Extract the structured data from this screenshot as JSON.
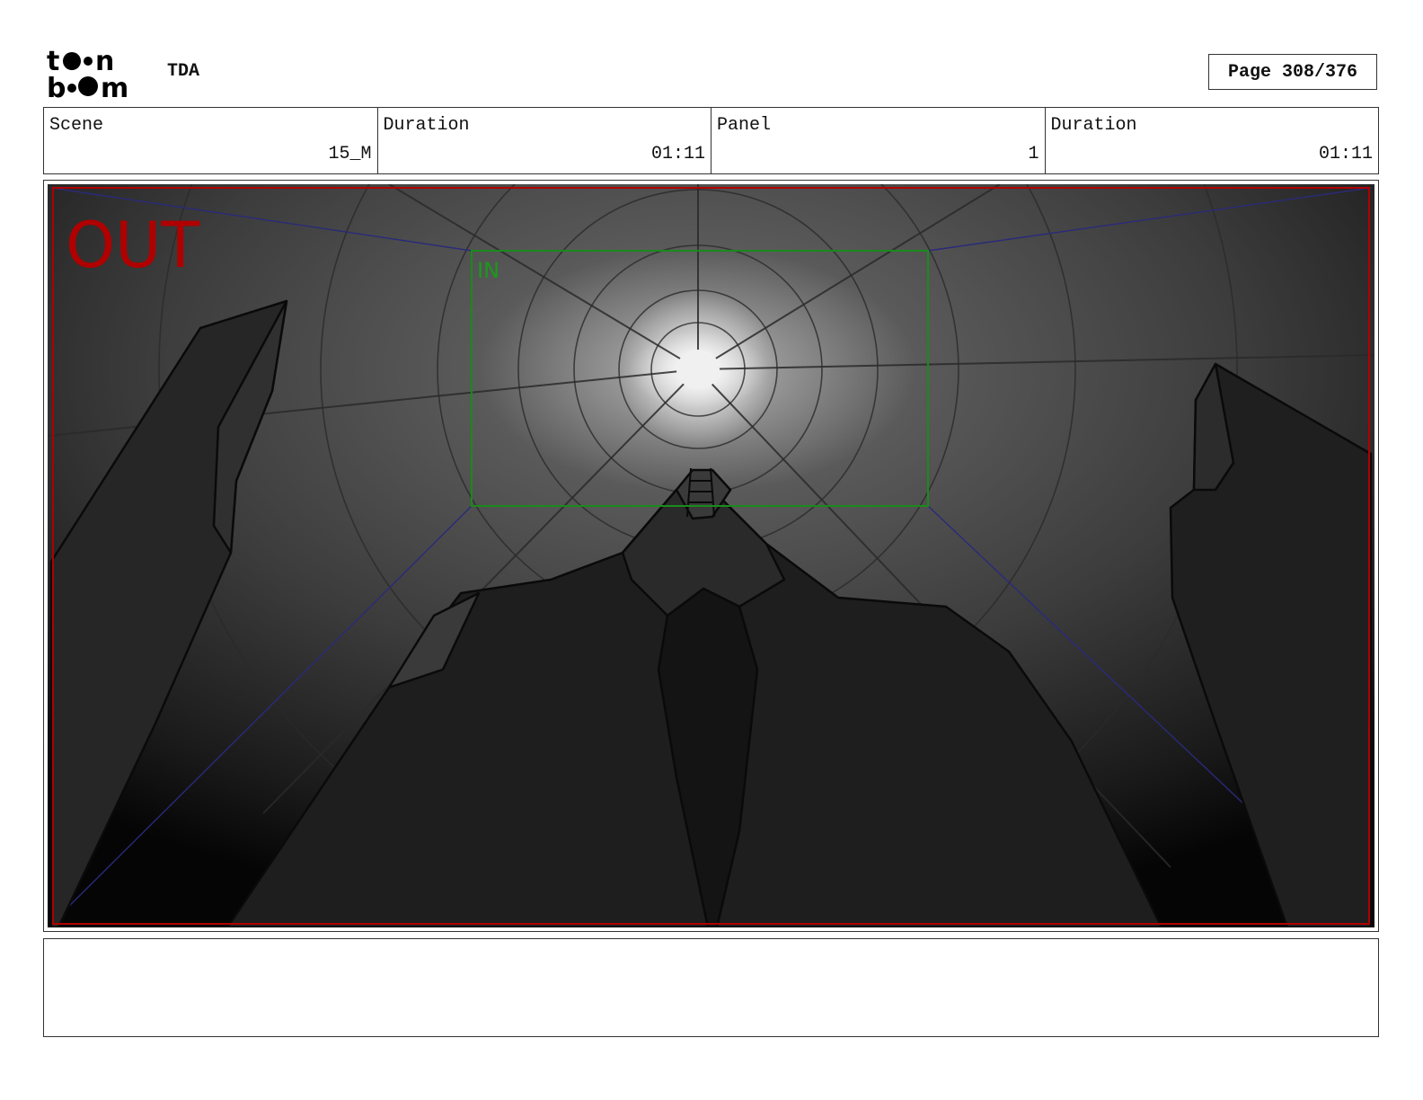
{
  "header": {
    "logo_text": "toon boom",
    "project": "TDA",
    "page": "Page 308/376"
  },
  "info": {
    "scene_label": "Scene",
    "scene_value": "15_M",
    "scene_duration_label": "Duration",
    "scene_duration_value": "01:11",
    "panel_label": "Panel",
    "panel_value": "1",
    "panel_duration_label": "Duration",
    "panel_duration_value": "01:11"
  },
  "panel": {
    "out_label": "OUT",
    "in_label": "IN",
    "colors": {
      "out_frame": "#b00000",
      "in_frame": "#1a8a1a",
      "guides": "#2a2a7a",
      "light": "#f0f0f0"
    }
  },
  "notes": {
    "text": ""
  }
}
